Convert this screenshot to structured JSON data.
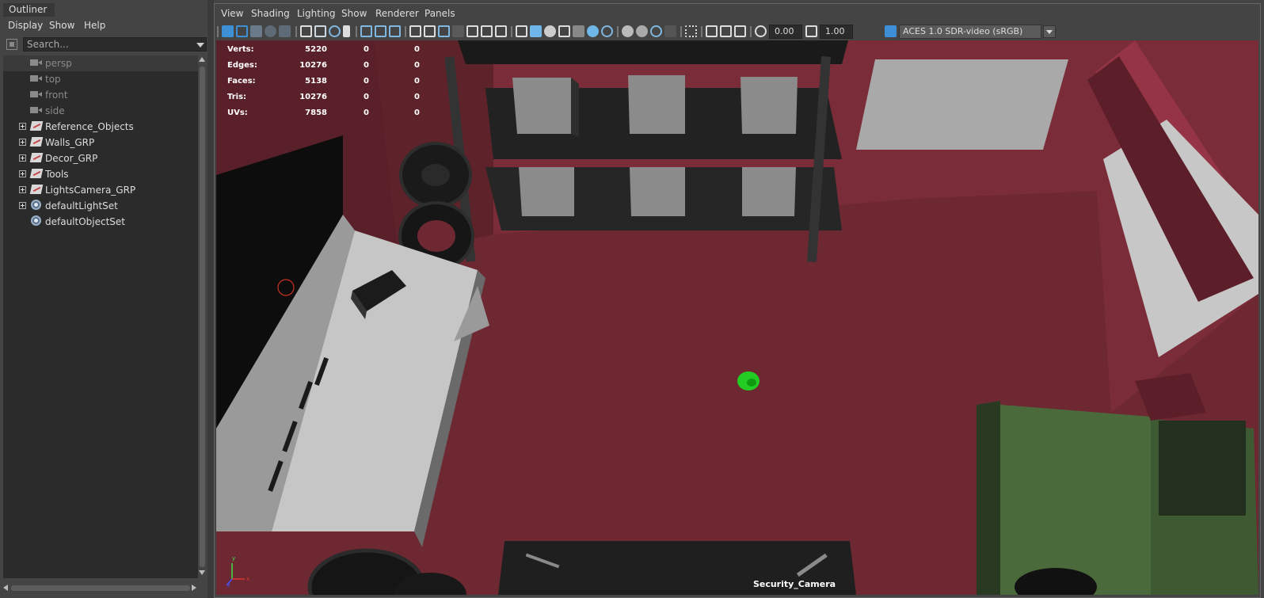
{
  "outliner": {
    "tab_title": "Outliner",
    "menu": [
      "Display",
      "Show",
      "Help"
    ],
    "search_placeholder": "Search...",
    "items": [
      {
        "label": "persp",
        "type": "camera",
        "dim": true,
        "selected": true
      },
      {
        "label": "top",
        "type": "camera",
        "dim": true
      },
      {
        "label": "front",
        "type": "camera",
        "dim": true
      },
      {
        "label": "side",
        "type": "camera",
        "dim": true
      },
      {
        "label": "Reference_Objects",
        "type": "group",
        "expandable": true
      },
      {
        "label": "Walls_GRP",
        "type": "group",
        "expandable": true
      },
      {
        "label": "Decor_GRP",
        "type": "group",
        "expandable": true
      },
      {
        "label": "Tools",
        "type": "group",
        "expandable": true
      },
      {
        "label": "LightsCamera_GRP",
        "type": "group",
        "expandable": true
      },
      {
        "label": "defaultLightSet",
        "type": "set",
        "expandable": true
      },
      {
        "label": "defaultObjectSet",
        "type": "set",
        "expandable": false
      }
    ]
  },
  "viewport": {
    "menu": [
      "View",
      "Shading",
      "Lighting",
      "Show",
      "Renderer",
      "Panels"
    ],
    "toolbar": {
      "exposure": "0.00",
      "gamma": "1.00",
      "color_space": "ACES 1.0 SDR-video (sRGB)"
    },
    "hud": [
      {
        "label": "Verts:",
        "values": [
          "5220",
          "0",
          "0"
        ]
      },
      {
        "label": "Edges:",
        "values": [
          "10276",
          "0",
          "0"
        ]
      },
      {
        "label": "Faces:",
        "values": [
          "5138",
          "0",
          "0"
        ]
      },
      {
        "label": "Tris:",
        "values": [
          "10276",
          "0",
          "0"
        ]
      },
      {
        "label": "UVs:",
        "values": [
          "7858",
          "0",
          "0"
        ]
      }
    ],
    "camera_name": "Security_Camera",
    "axis_labels": {
      "x": "x",
      "y": "y",
      "z": "z"
    }
  },
  "colors": {
    "floor": "#6e2832",
    "wall": "#7a2c38",
    "panel_bg": "#444444",
    "tree_bg": "#2b2b2b",
    "truck": "#3e5a32",
    "selected_object": "#22cc22"
  }
}
